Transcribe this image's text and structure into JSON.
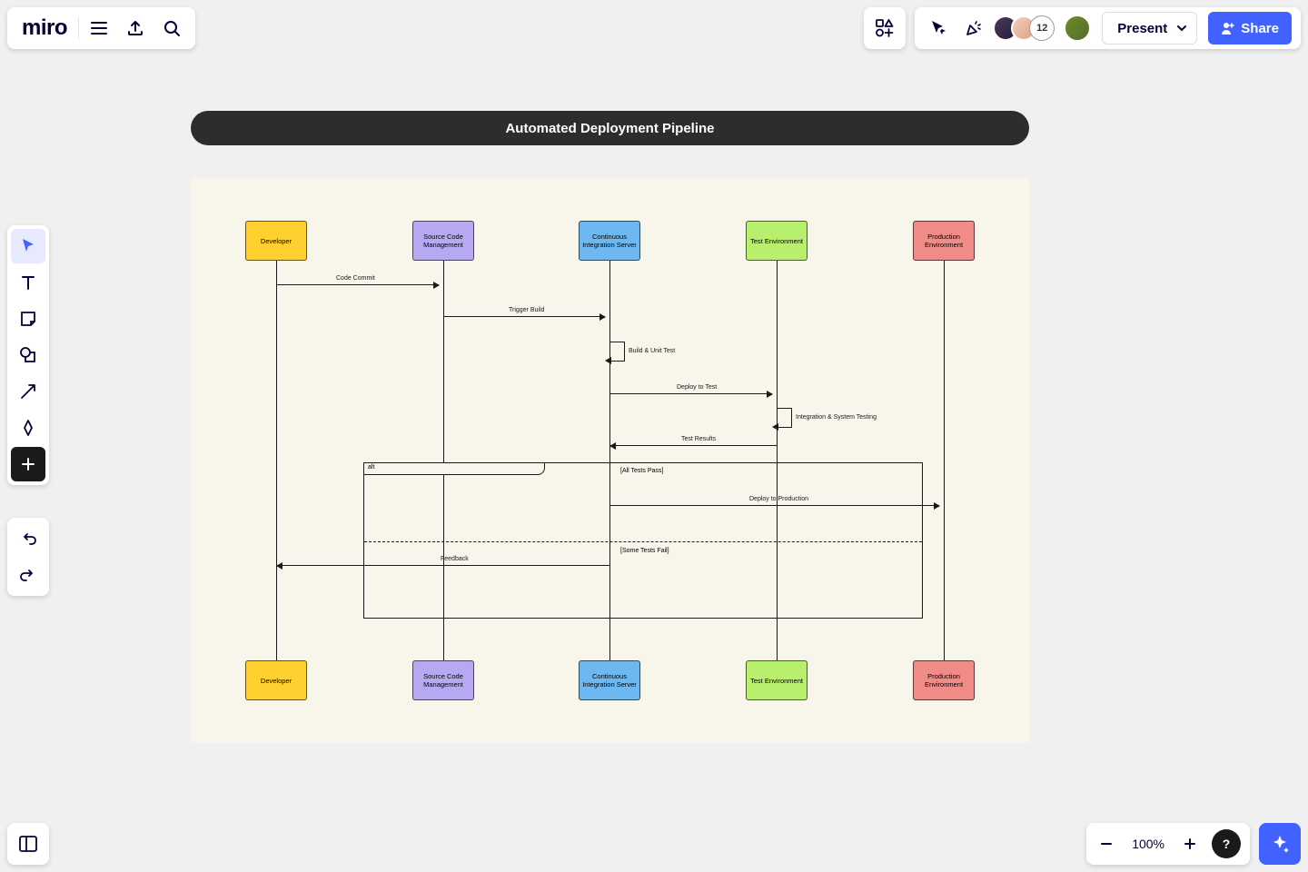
{
  "app": {
    "logo": "miro"
  },
  "collab": {
    "overflow_count": "12"
  },
  "present": {
    "label": "Present"
  },
  "share": {
    "label": "Share"
  },
  "zoom": {
    "level": "100%"
  },
  "canvas": {
    "title": "Automated Deployment Pipeline"
  },
  "actors": {
    "dev": "Developer",
    "scm": "Source Code Management",
    "ci": "Continuous Integration Server",
    "test": "Test Environment",
    "prod": "Production Environment"
  },
  "messages": {
    "commit": "Code Commit",
    "trigger": "Trigger Build",
    "build": "Build & Unit Test",
    "deploy_t": "Deploy to Test",
    "int_sys": "Integration & System Testing",
    "results": "Test Results",
    "deploy_p": "Deploy to Production",
    "feedback": "Feedback"
  },
  "alt": {
    "label": "alt",
    "cond_pass": "[All Tests Pass]",
    "cond_fail": "[Some Tests Fail]"
  }
}
